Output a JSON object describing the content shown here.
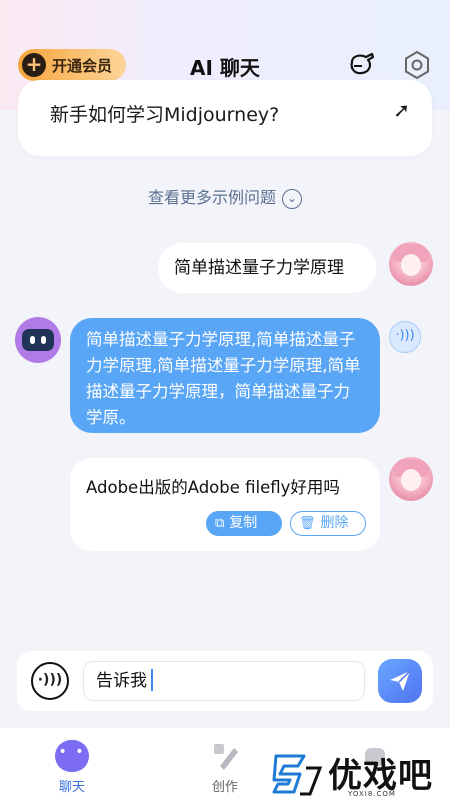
{
  "header": {
    "vip_label": "开通会员",
    "title": "AI 聊天"
  },
  "suggested": {
    "question": "新手如何学习Midjourney?",
    "more_label": "查看更多示例问题"
  },
  "messages": [
    {
      "role": "user",
      "text": "简单描述量子力学原理"
    },
    {
      "role": "bot",
      "text": "简单描述量子力学原理,简单描述量子力学原理,简单描述量子力学原理,简单描述量子力学原理，简单描述量子力学原。"
    },
    {
      "role": "user",
      "text": "Adobe出版的Adobe filefly好用吗",
      "actions": {
        "copy": "复制",
        "delete": "删除"
      }
    }
  ],
  "input": {
    "value": "告诉我"
  },
  "tabs": [
    {
      "label": "聊天",
      "icon": "chat-icon",
      "active": true
    },
    {
      "label": "创作",
      "icon": "create-icon",
      "active": false
    }
  ],
  "watermark": {
    "text": "优戏吧",
    "sub": "YOXI8.COM"
  },
  "colors": {
    "accent": "#5aa6f6",
    "vip": "#f7a53d",
    "send": "#4f73f2"
  }
}
